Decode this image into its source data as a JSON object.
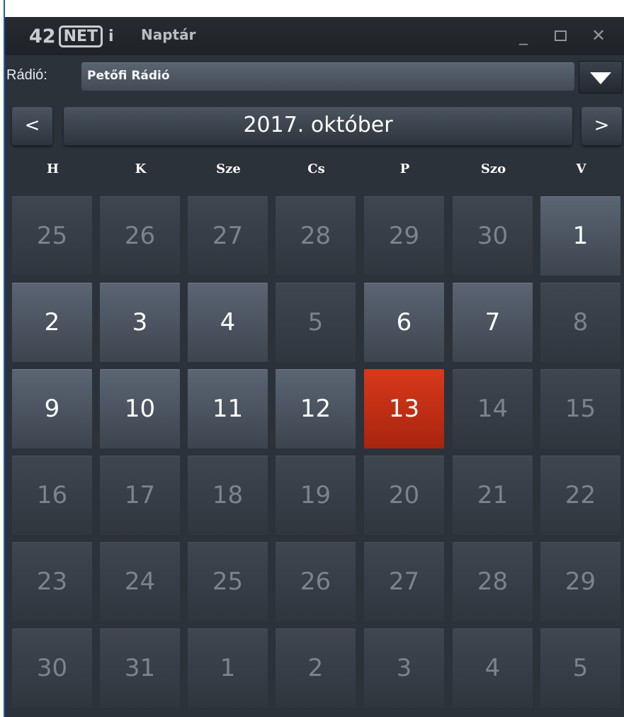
{
  "window": {
    "logo": {
      "part1": "42",
      "part2": "NET",
      "part3": "i"
    },
    "title": "Naptár",
    "controls": {
      "minimize": "_",
      "close": "✕"
    }
  },
  "radio": {
    "label": "Rádió:",
    "selected": "Petőfi Rádió"
  },
  "calendar": {
    "prev": "<",
    "next": ">",
    "month_label": "2017. október",
    "weekdays": [
      "H",
      "K",
      "Sze",
      "Cs",
      "P",
      "Szo",
      "V"
    ],
    "weeks": [
      [
        {
          "d": "25",
          "s": "inactive"
        },
        {
          "d": "26",
          "s": "inactive"
        },
        {
          "d": "27",
          "s": "inactive"
        },
        {
          "d": "28",
          "s": "inactive"
        },
        {
          "d": "29",
          "s": "inactive"
        },
        {
          "d": "30",
          "s": "inactive"
        },
        {
          "d": "1",
          "s": "active"
        }
      ],
      [
        {
          "d": "2",
          "s": "active"
        },
        {
          "d": "3",
          "s": "active"
        },
        {
          "d": "4",
          "s": "active"
        },
        {
          "d": "5",
          "s": "inactive"
        },
        {
          "d": "6",
          "s": "active"
        },
        {
          "d": "7",
          "s": "active"
        },
        {
          "d": "8",
          "s": "inactive"
        }
      ],
      [
        {
          "d": "9",
          "s": "active"
        },
        {
          "d": "10",
          "s": "active"
        },
        {
          "d": "11",
          "s": "active"
        },
        {
          "d": "12",
          "s": "active"
        },
        {
          "d": "13",
          "s": "today"
        },
        {
          "d": "14",
          "s": "inactive"
        },
        {
          "d": "15",
          "s": "inactive"
        }
      ],
      [
        {
          "d": "16",
          "s": "inactive"
        },
        {
          "d": "17",
          "s": "inactive"
        },
        {
          "d": "18",
          "s": "inactive"
        },
        {
          "d": "19",
          "s": "inactive"
        },
        {
          "d": "20",
          "s": "inactive"
        },
        {
          "d": "21",
          "s": "inactive"
        },
        {
          "d": "22",
          "s": "inactive"
        }
      ],
      [
        {
          "d": "23",
          "s": "inactive"
        },
        {
          "d": "24",
          "s": "inactive"
        },
        {
          "d": "25",
          "s": "inactive"
        },
        {
          "d": "26",
          "s": "inactive"
        },
        {
          "d": "27",
          "s": "inactive"
        },
        {
          "d": "28",
          "s": "inactive"
        },
        {
          "d": "29",
          "s": "inactive"
        }
      ],
      [
        {
          "d": "30",
          "s": "inactive"
        },
        {
          "d": "31",
          "s": "inactive"
        },
        {
          "d": "1",
          "s": "inactive"
        },
        {
          "d": "2",
          "s": "inactive"
        },
        {
          "d": "3",
          "s": "inactive"
        },
        {
          "d": "4",
          "s": "inactive"
        },
        {
          "d": "5",
          "s": "inactive"
        }
      ]
    ]
  },
  "colors": {
    "background": "#2c323a",
    "today": "#c9301a",
    "active_day": "#4c5561",
    "inactive_day": "#373e47"
  }
}
